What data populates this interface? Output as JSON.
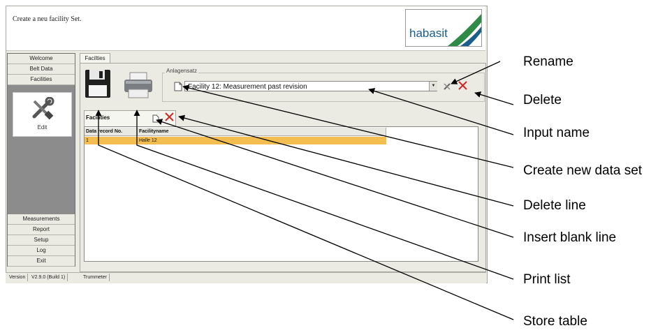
{
  "header": {
    "text": "Create a neu facility Set.",
    "logo_text": "habasit"
  },
  "sidebar": {
    "top_items": [
      "Welcome",
      "Belt Data",
      "Facilities"
    ],
    "active_label": "Edit",
    "bottom_items": [
      "Measurements",
      "Report",
      "Setup",
      "Log",
      "Exit"
    ]
  },
  "main": {
    "tab_label": "Facilties",
    "group_label": "Anlagensatz",
    "combo_value": "Facility 12: Measurement past revision",
    "table_tab_label": "Facilities",
    "columns": [
      "Data record No.",
      "Facilityname"
    ],
    "rows": [
      {
        "no": "1",
        "name": "Halle 12"
      }
    ]
  },
  "status": {
    "version_label": "Version",
    "version_value": "V2.9.0  (Build 1)",
    "device": "Trummeter"
  },
  "annotations": {
    "rename": "Rename",
    "delete": "Delete",
    "input_name": "Input name",
    "create_new": "Create new data set",
    "delete_line": "Delete line",
    "insert_blank": "Insert blank line",
    "print_list": "Print list",
    "store_table": "Store table"
  },
  "colors": {
    "selected_row": "#f4bd4f",
    "sidebar_dark": "#8c8c8c",
    "logo_blue": "#1b5e8c",
    "logo_green": "#2f8a48",
    "delete_red": "#d02828"
  }
}
